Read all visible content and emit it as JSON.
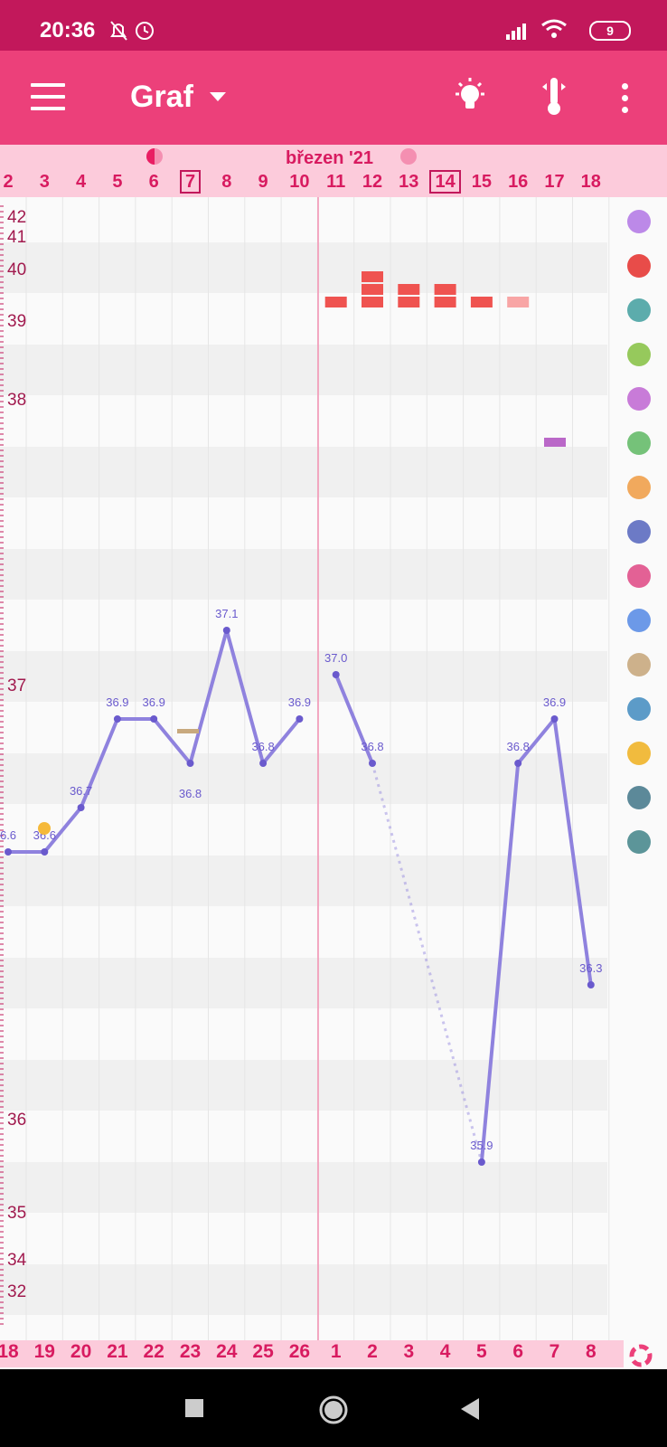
{
  "status": {
    "time": "20:36",
    "battery": "9"
  },
  "appbar": {
    "title": "Graf",
    "icons": [
      "menu-icon",
      "lightbulb-icon",
      "thermometer-icon",
      "more-vert-icon"
    ]
  },
  "calendar": {
    "month_label": "březen '21",
    "days": [
      "2",
      "3",
      "4",
      "5",
      "6",
      "7",
      "8",
      "9",
      "10",
      "11",
      "12",
      "13",
      "14",
      "15",
      "16",
      "17",
      "18"
    ],
    "boxed_days": [
      "7",
      "14"
    ],
    "cycle_days": [
      "18",
      "19",
      "20",
      "21",
      "22",
      "23",
      "24",
      "25",
      "26",
      "1",
      "2",
      "3",
      "4",
      "5",
      "6",
      "7",
      "8"
    ]
  },
  "y_axis_labels": [
    "42",
    "41",
    "40",
    "39",
    "38",
    "37",
    "36",
    "35",
    "34",
    "32"
  ],
  "side_icons": [
    "flower-icon",
    "blood-drop-icon",
    "splash-icon",
    "rings-icon",
    "heart-icon",
    "leaf-icon",
    "pill-bottle-icon",
    "smiley-icon",
    "body-pain-icon",
    "document-icon",
    "pregnancy-test-icon",
    "snowflake-icon",
    "sun-alert-icon",
    "magnifier-check-icon",
    "stopwatch-icon",
    "cycle-ring-icon"
  ],
  "chart_data": {
    "type": "line",
    "x": [
      "2",
      "3",
      "4",
      "5",
      "6",
      "7",
      "8",
      "9",
      "10",
      "11",
      "12",
      "13",
      "14",
      "15",
      "16",
      "17",
      "18"
    ],
    "series": [
      {
        "values": [
          36.6,
          36.6,
          36.7,
          36.9,
          36.9,
          36.8,
          37.1,
          36.8,
          36.9,
          37.0,
          36.8,
          null,
          null,
          35.9,
          36.8,
          36.9,
          36.3
        ]
      }
    ],
    "point_labels": [
      "6.6",
      "36.6",
      "36.7",
      "36.9",
      "36.9",
      "36.8",
      "37.1",
      "36.8",
      "36.9",
      "37.0",
      "36.8",
      "",
      "",
      "35.9",
      "36.8",
      "36.9",
      "36.3"
    ],
    "bleeding_days": {
      "11": 1,
      "12": 3,
      "13": 2,
      "14": 2,
      "15": 1,
      "16": 1
    },
    "colors": {
      "temperature": "#8f82de",
      "bleeding": "#ef5350",
      "accent": "#ec407a",
      "marker": "#ba68c8"
    }
  }
}
